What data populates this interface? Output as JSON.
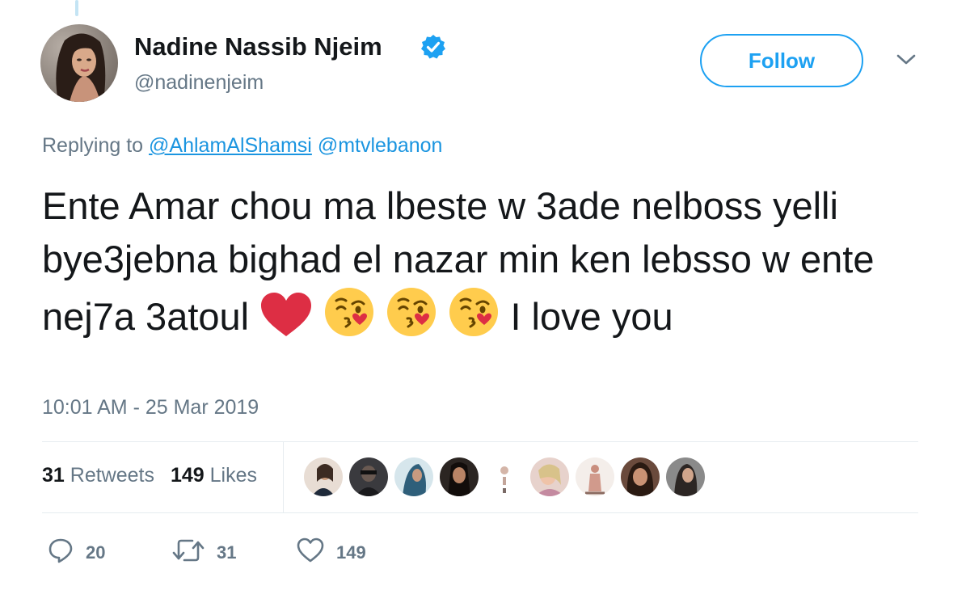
{
  "tweet": {
    "author": {
      "display_name": "Nadine Nassib Njeim",
      "handle": "@nadinenjeim",
      "verified": true,
      "avatar_icon": "profile-photo"
    },
    "follow_label": "Follow",
    "replying_prefix": "Replying to",
    "replying_to": [
      "@AhlamAlShamsi",
      "@mtvlebanon"
    ],
    "text_before_emoji": "Ente Amar chou ma lbeste w 3ade nelboss yelli bye3jebna bighad el nazar min ken lebsso w ente  nej7a 3atoul",
    "emojis": [
      "red-heart",
      "face-blowing-kiss",
      "face-blowing-kiss",
      "face-blowing-kiss"
    ],
    "text_after_emoji": "I love you",
    "timestamp": "10:01 AM - 25 Mar 2019"
  },
  "stats": {
    "retweets_count": "31",
    "retweets_label": "Retweets",
    "likes_count": "149",
    "likes_label": "Likes",
    "liker_avatar_count": 9
  },
  "actions": {
    "reply_count": "20",
    "retweet_count": "31",
    "like_count": "149"
  },
  "colors": {
    "accent": "#1da1f2",
    "link": "#1b95e0",
    "muted": "#657786",
    "text": "#14171a",
    "heart": "#e0245e"
  }
}
